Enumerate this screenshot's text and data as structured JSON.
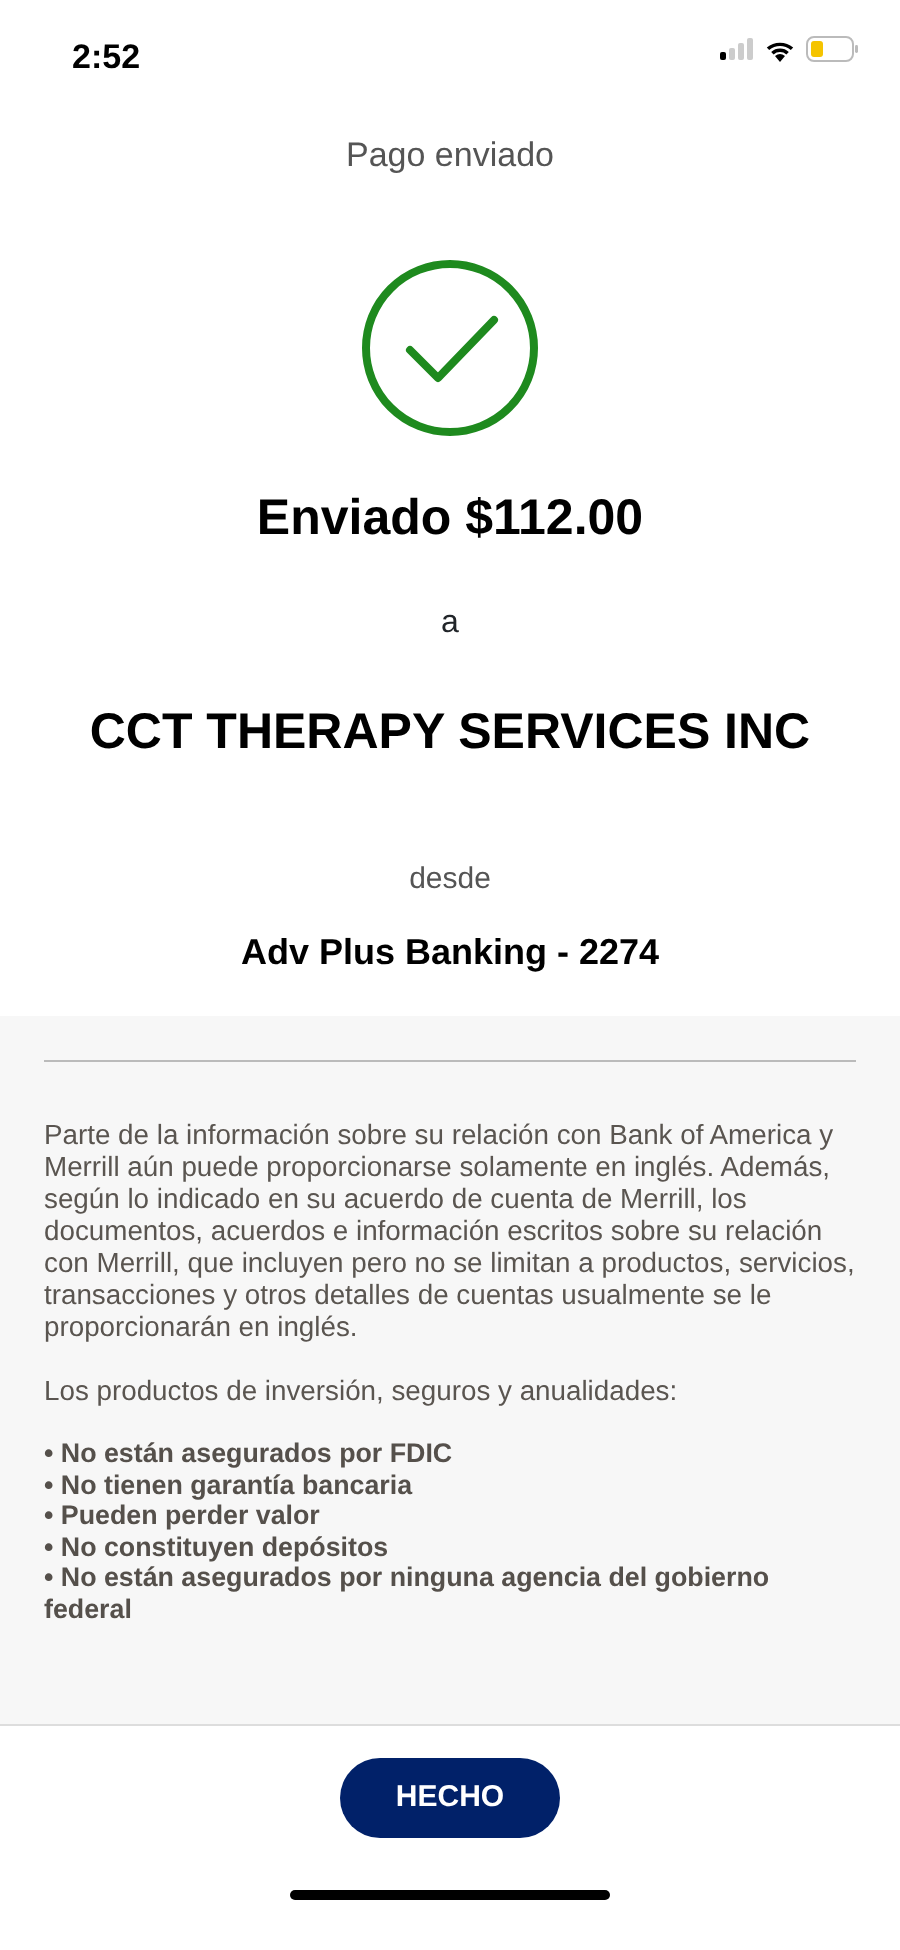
{
  "status_bar": {
    "time": "2:52"
  },
  "header": {
    "title": "Pago enviado"
  },
  "confirmation": {
    "amount_line": "Enviado $112.00",
    "to_word": "a",
    "payee": "CCT THERAPY SERVICES INC",
    "from_word": "desde",
    "account": "Adv Plus Banking - 2274"
  },
  "disclosure": {
    "paragraph": "Parte de la información sobre su relación con Bank of America y Merrill aún puede proporcionarse solamente en inglés. Además, según lo indicado en su acuerdo de cuenta de Merrill, los documentos, acuerdos e información escritos sobre su relación con Merrill, que incluyen pero no se limitan a productos, servicios, transacciones y otros detalles de cuentas usualmente se le proporcionarán en inglés.",
    "intro": "Los productos de inversión, seguros y anualidades:",
    "bullets": [
      "• No están asegurados por FDIC",
      "• No tienen garantía bancaria",
      "• Pueden perder valor",
      "• No constituyen depósitos",
      "• No están asegurados por ninguna agencia del gobierno federal"
    ]
  },
  "done_button": {
    "label": "HECHO"
  }
}
